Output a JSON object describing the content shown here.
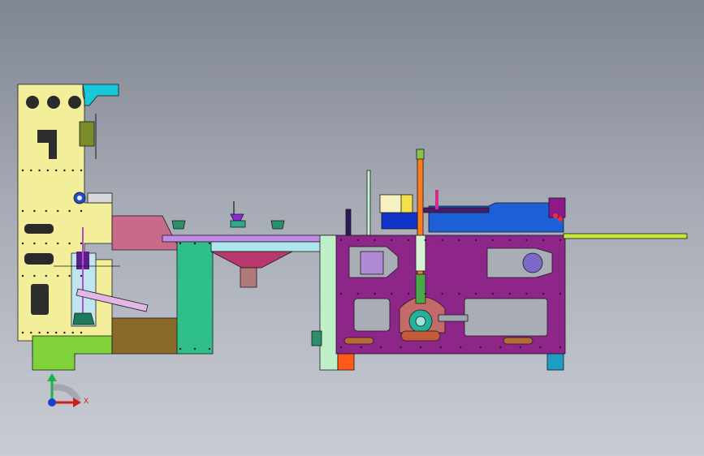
{
  "viewport": {
    "background_top": "#7f8592",
    "background_bottom": "#c9ccd3"
  },
  "colors": {
    "left_frame": "#f3ee9a",
    "left_base": "#7fd23a",
    "pink_bridge": "#c86a8a",
    "brown_block": "#8a6a2a",
    "green_column": "#2fbf8a",
    "lavender_beam": "#c08be6",
    "light_cyan": "#aee6ee",
    "hopper": "#b9386c",
    "cup": "#b07a7a",
    "purple_frame": "#8e268a",
    "blue_head": "#1c5fd6",
    "orange_rod": "#ff7a1a",
    "mint_plate": "#bff0c8",
    "lime_rail": "#c6e838",
    "teal_foot": "#1e9cc4",
    "orange_foot": "#ff5a1a",
    "cyan_cap": "#16c8d8"
  },
  "triad": {
    "x_label": "X",
    "x_color": "#d21c1c",
    "y_color": "#22b04a",
    "z_color": "#1a3fcf"
  }
}
